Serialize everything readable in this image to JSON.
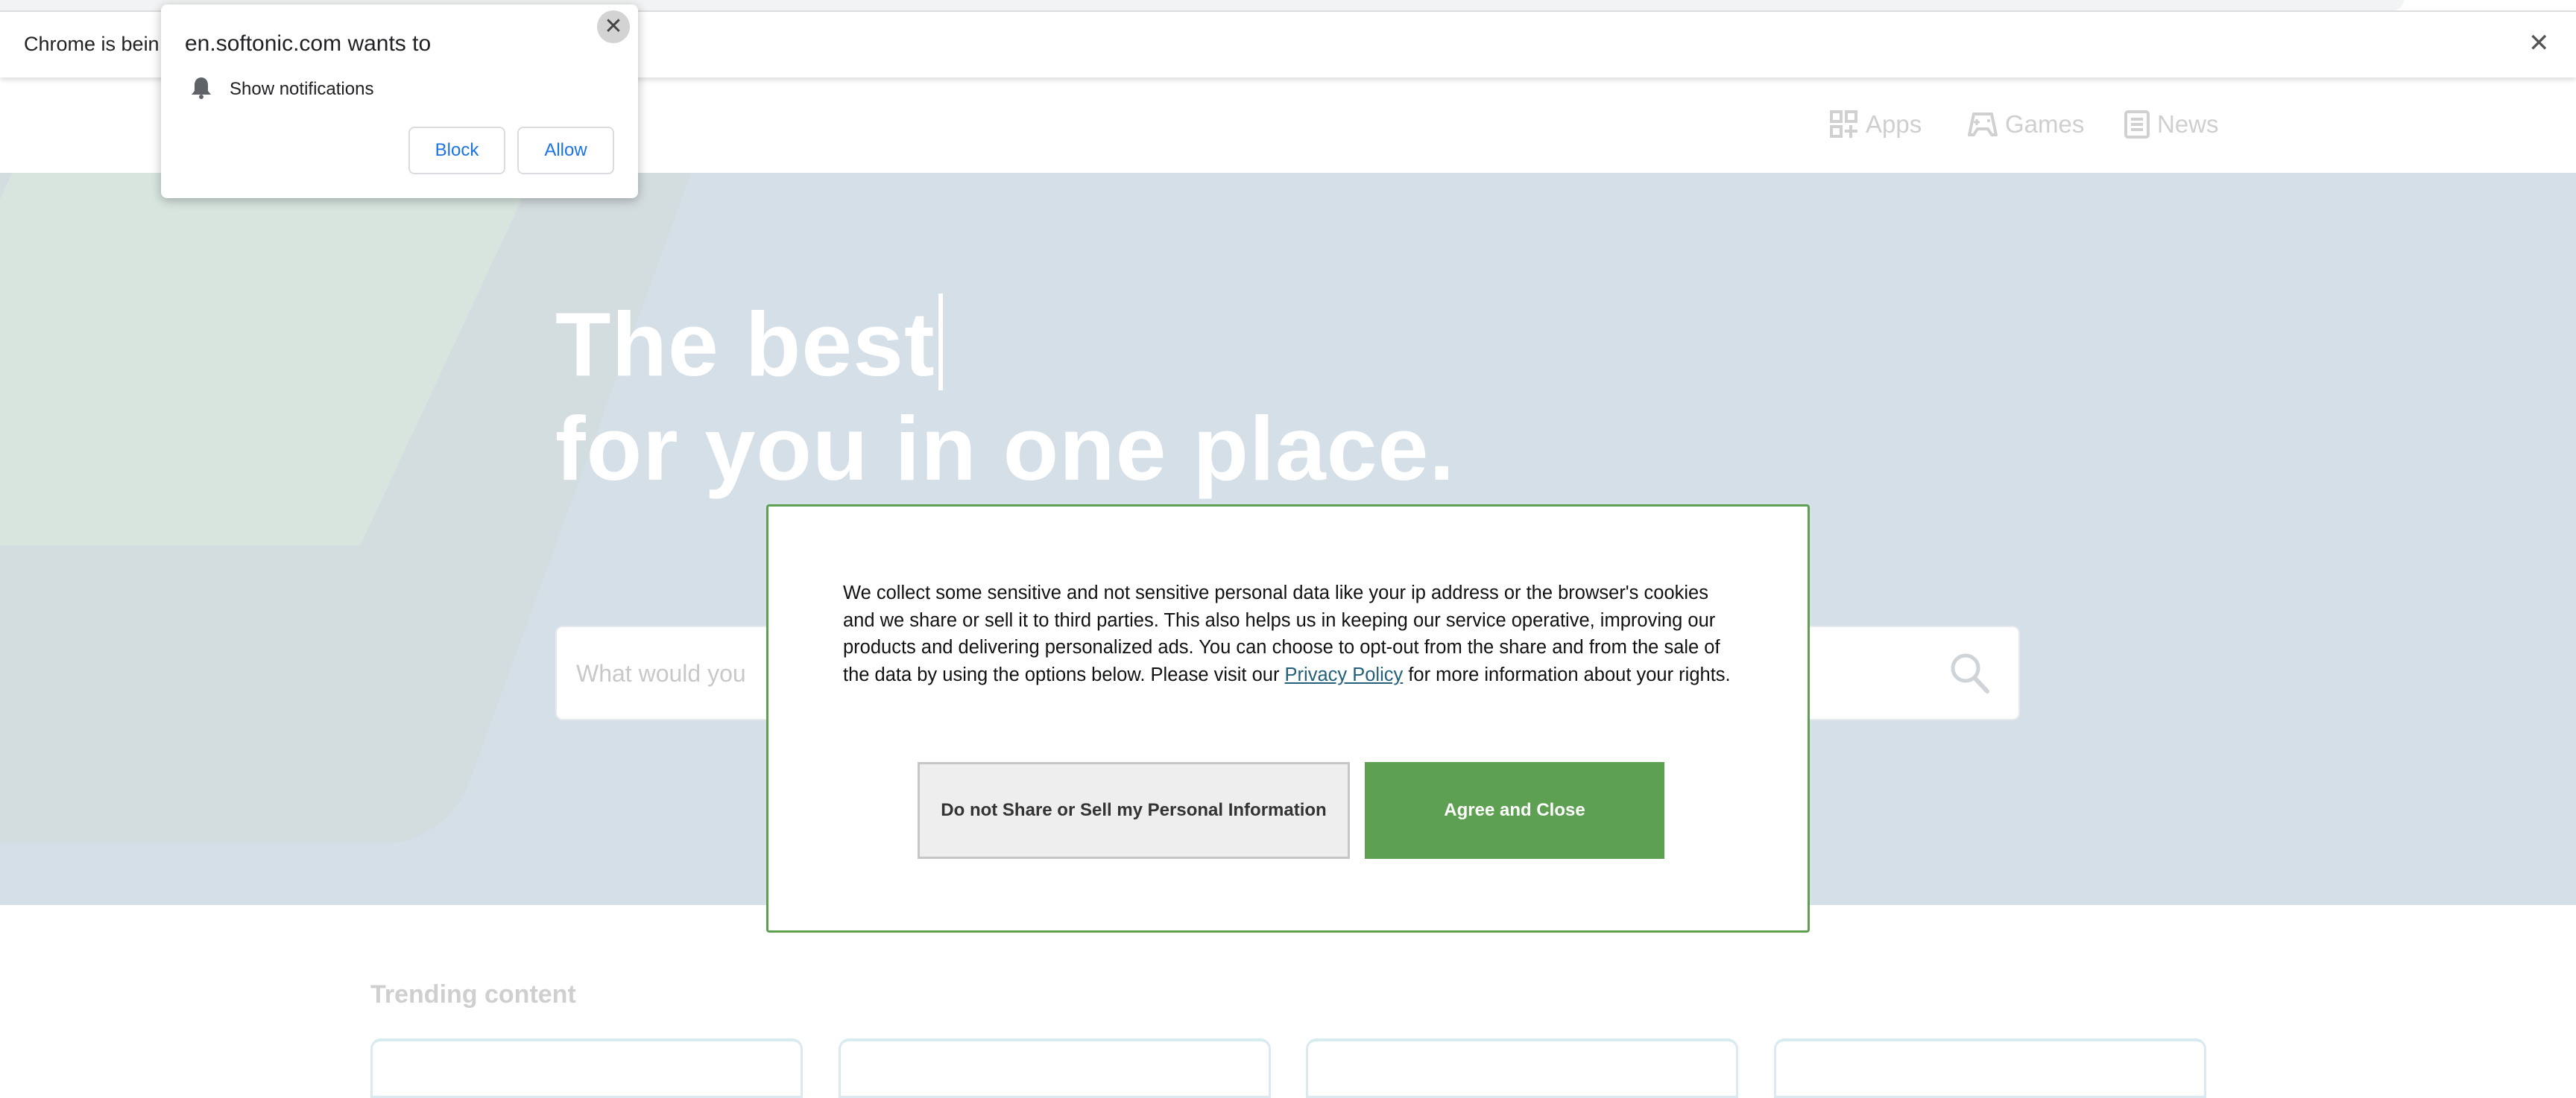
{
  "infobar": {
    "text": "Chrome is bein",
    "close": "✕"
  },
  "popup": {
    "title": "en.softonic.com wants to",
    "close": "✕",
    "permission": "Show notifications",
    "block": "Block",
    "allow": "Allow"
  },
  "nav": {
    "items": [
      {
        "label": "Apps",
        "icon": "apps-grid-icon"
      },
      {
        "label": "Games",
        "icon": "gamepad-icon"
      },
      {
        "label": "News",
        "icon": "newspaper-icon"
      }
    ]
  },
  "hero": {
    "line1": "The best",
    "line2": "for you in one place.",
    "search_placeholder": "What would you"
  },
  "consent": {
    "text_before": "We collect some sensitive and not sensitive personal data like your ip address or the browser's cookies and we share or sell it to third parties. This also helps us in keeping our service operative, improving our products and delivering personalized ads. You can choose to opt-out from the share and from the sale of the data by using the options below. Please visit our ",
    "link": "Privacy Policy",
    "text_after": " for more information about your rights.",
    "deny": "Do not Share or Sell my Personal Information",
    "agree": "Agree and Close"
  },
  "trending": {
    "title": "Trending content"
  },
  "colors": {
    "accent_green": "#5ea052",
    "link": "#24607a",
    "chrome_blue": "#1a73e8",
    "hero_bg": "#d5dfe8"
  }
}
